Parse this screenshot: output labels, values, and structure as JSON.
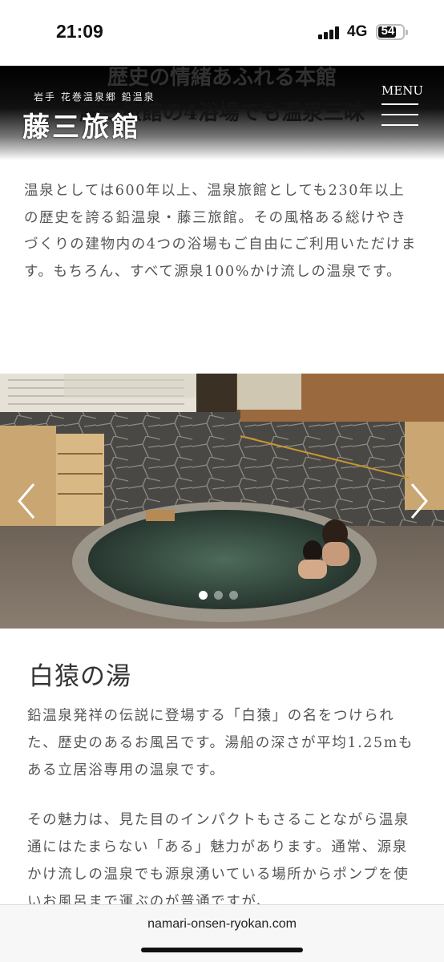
{
  "status": {
    "time": "21:09",
    "network": "4G",
    "battery": "54"
  },
  "header": {
    "hidden_title_1": "歴史の情緒あふれる本館",
    "hidden_title_2": "藤三旅館の4浴場でも温泉三昧",
    "brand_sub": "岩手 花巻温泉郷 鉛温泉",
    "brand_main": "藤三旅館",
    "menu_label": "MENU"
  },
  "intro_text": "温泉としては600年以上、温泉旅館としても230年以上の歴史を誇る鉛温泉・藤三旅館。その風格ある総けやきづくりの建物内の4つの浴場もご自由にご利用いただけます。もちろん、すべて源泉100%かけ流しの温泉です。",
  "carousel": {
    "slide_count": 3,
    "active_index": 0
  },
  "section": {
    "title": "白猿の湯",
    "para1": "鉛温泉発祥の伝説に登場する「白猿」の名をつけられた、歴史のあるお風呂です。湯船の深さが平均1.25mもある立居浴専用の温泉です。",
    "para2": "その魅力は、見た目のインパクトもさることながら温泉通にはたまらない「ある」魅力があります。通常、源泉かけ流しの温泉でも源泉湧いている場所からポンプを使いお風呂まで運ぶのが普通ですが、"
  },
  "browser": {
    "url": "namari-onsen-ryokan.com"
  }
}
